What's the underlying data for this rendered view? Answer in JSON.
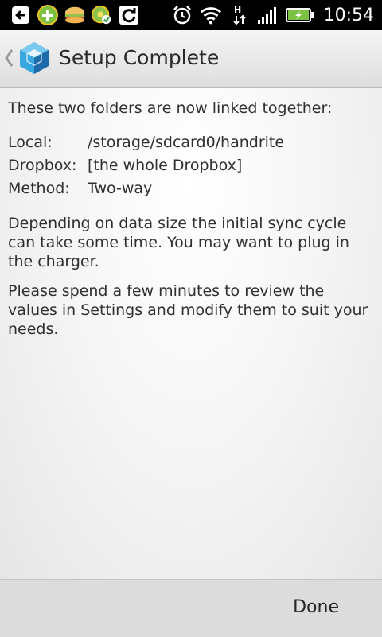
{
  "status_bar": {
    "time": "10:54",
    "notification_icons": [
      "back-arrow-icon",
      "plus-badge-icon",
      "sandwich-icon",
      "sync-check-icon",
      "refresh-icon"
    ],
    "system_icons": [
      "alarm-icon",
      "wifi-icon",
      "hspa-data-icon",
      "signal-icon",
      "battery-charging-icon"
    ]
  },
  "action_bar": {
    "title": "Setup Complete",
    "app_icon": "dropsync-box-icon"
  },
  "content": {
    "intro": "These two folders are now linked together:",
    "rows": [
      {
        "label": "Local:",
        "value": "/storage/sdcard0/handrite"
      },
      {
        "label": "Dropbox:",
        "value": "[the whole Dropbox]"
      },
      {
        "label": "Method:",
        "value": "Two-way"
      }
    ],
    "paragraph1": "Depending on data size the initial sync cycle can take some time. You may want to plug in the charger.",
    "paragraph2": "Please spend a few minutes to review the values in Settings and modify them to suit your needs."
  },
  "bottom_bar": {
    "done_label": "Done"
  },
  "colors": {
    "status_bar_bg": "#000000",
    "action_bar_bg": "#e8e8e8",
    "text": "#2f2f2f",
    "battery_green": "#7bc142",
    "app_icon_blue": "#3aa8e0"
  }
}
